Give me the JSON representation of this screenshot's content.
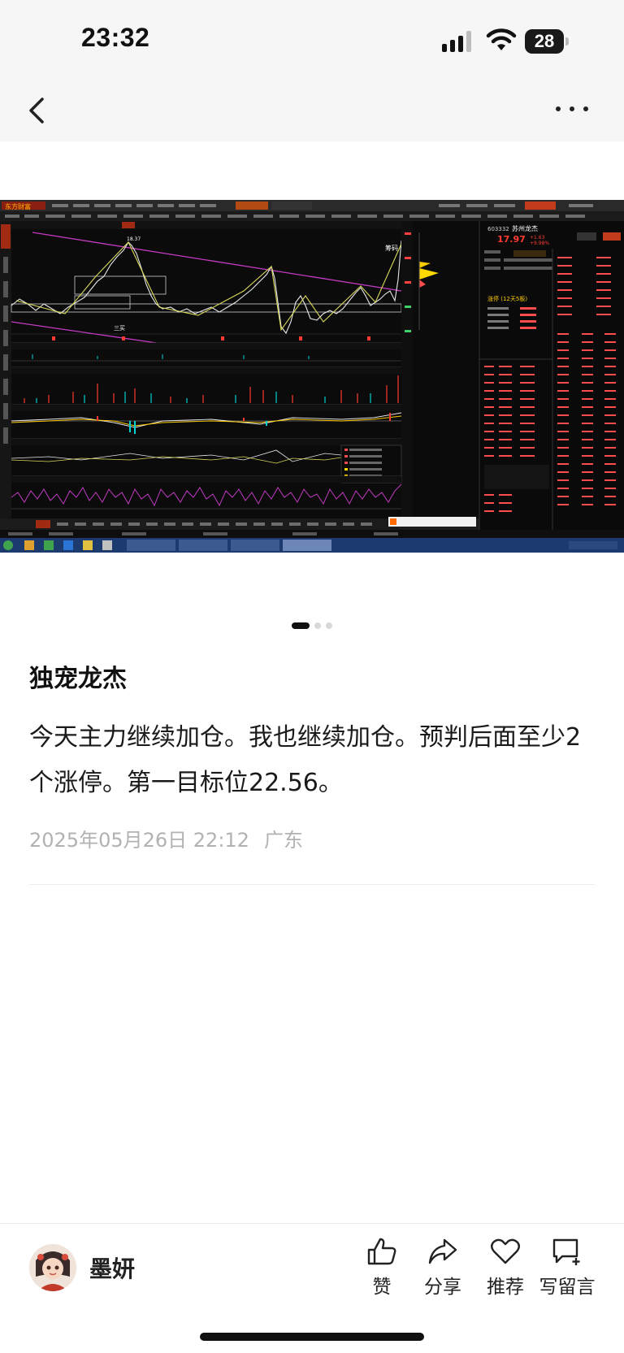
{
  "status_bar": {
    "time": "23:32",
    "battery": "28"
  },
  "post": {
    "title": "独宠龙杰",
    "body": "今天主力继续加仓。我也继续加仓。预判后面至少2个涨停。第一目标位22.56。",
    "date": "2025年05月26日 22:12",
    "location": "广东"
  },
  "carousel": {
    "current": 1,
    "total": 3
  },
  "screenshot": {
    "app_name": "东方财富",
    "stock_code": "603332",
    "stock_name": "苏州龙杰",
    "price": "17.97",
    "change": "+1.63",
    "change_pct": "+9.98%",
    "high_label": "18.37",
    "annotation_1": "筹码",
    "annotation_2": "三买",
    "panel_title": "涨停 (12天5板)",
    "colors": {
      "bg": "#0b0b0b",
      "up": "#ff3b30",
      "down": "#00d3d3",
      "price_line": "#e8e8e8",
      "trend": "#c23bc2",
      "zigzag": "#d8d85a"
    }
  },
  "author": {
    "name": "墨妍"
  },
  "actions": {
    "like": "赞",
    "share": "分享",
    "recommend": "推荐",
    "comment": "写留言"
  }
}
